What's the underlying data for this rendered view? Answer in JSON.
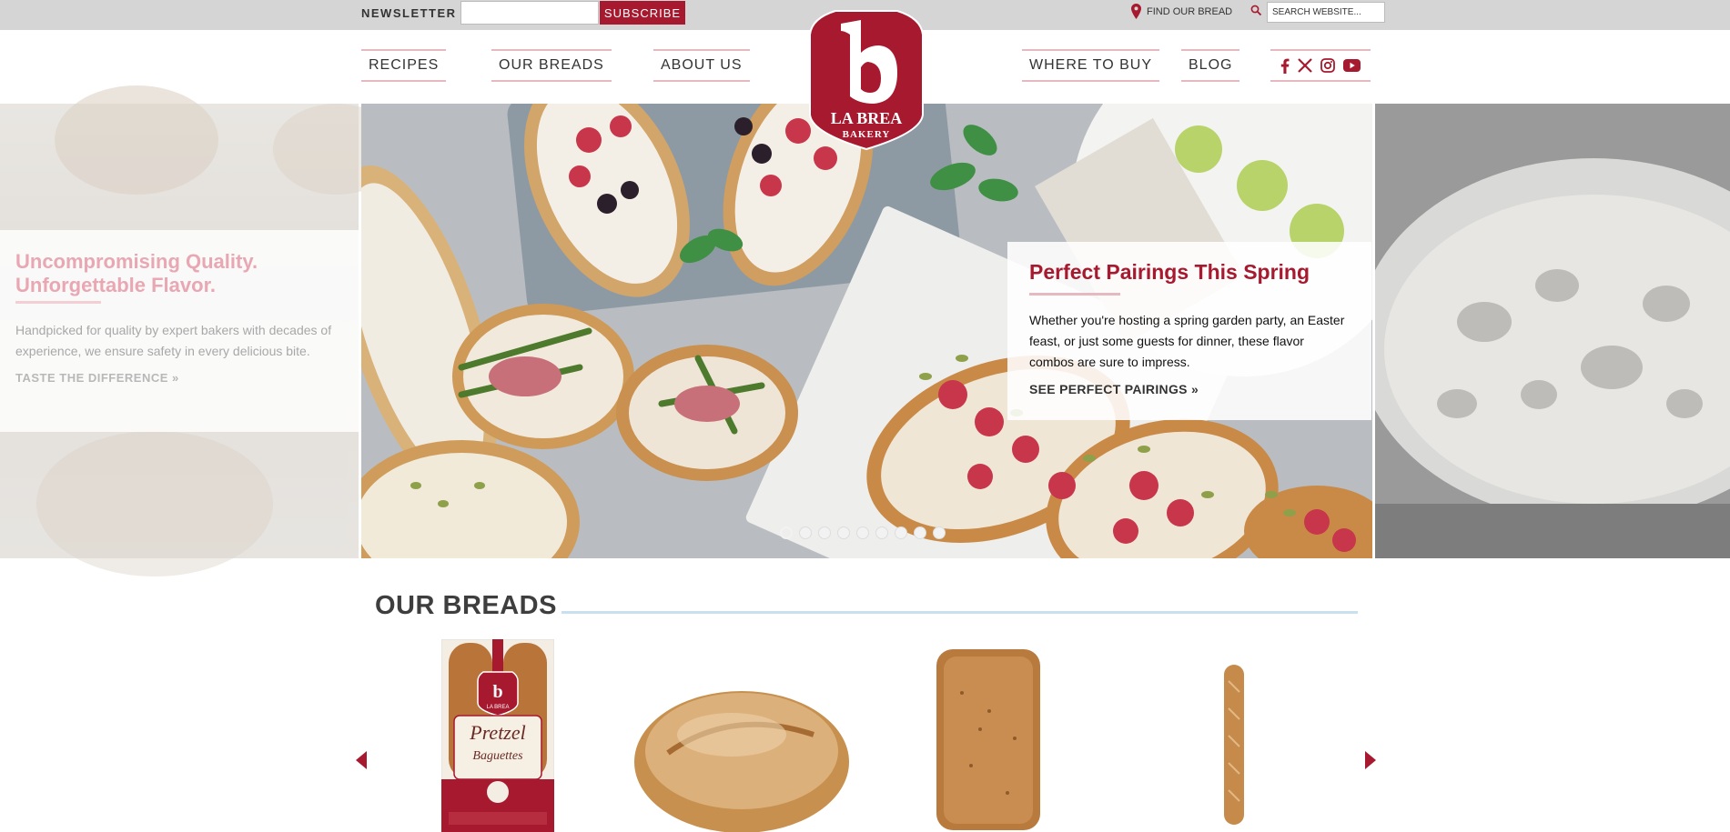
{
  "topbar": {
    "newsletter_label": "NEWSLETTER",
    "newsletter_value": "",
    "subscribe_label": "SUBSCRIBE",
    "find_bread_label": "FIND OUR BREAD",
    "search_placeholder": "SEARCH WEBSITE..."
  },
  "nav": {
    "recipes": "RECIPES",
    "our_breads": "OUR BREADS",
    "about_us": "ABOUT US",
    "where_to_buy": "WHERE TO BUY",
    "blog": "BLOG"
  },
  "social_icons": [
    "facebook-icon",
    "x-icon",
    "instagram-icon",
    "youtube-icon"
  ],
  "logo": {
    "letter": "b",
    "name": "LA BREA",
    "sub": "BAKERY"
  },
  "hero": {
    "prev_card": {
      "title_line1": "Uncompromising Quality.",
      "title_line2": "Unforgettable Flavor.",
      "text": "Handpicked for quality by expert bakers with decades of experience, we ensure safety in every delicious bite.",
      "link": "TASTE THE DIFFERENCE »"
    },
    "active_card": {
      "title": "Perfect Pairings This Spring",
      "text": "Whether you're hosting a spring garden party, an Easter feast, or just some guests for dinner, these flavor combos are sure to impress.",
      "link": "SEE PERFECT PAIRINGS »"
    },
    "slide_count": 9,
    "active_slide": 1
  },
  "breads": {
    "title": "OUR BREADS",
    "package": {
      "brand": "LA BREA",
      "name_line1": "Pretzel",
      "name_line2": "Baguettes"
    }
  },
  "colors": {
    "brand_red": "#a6192e",
    "nav_rule": "#e6b9c0",
    "section_rule": "#c7e1ee",
    "topbar_bg": "#d5d5d5"
  }
}
